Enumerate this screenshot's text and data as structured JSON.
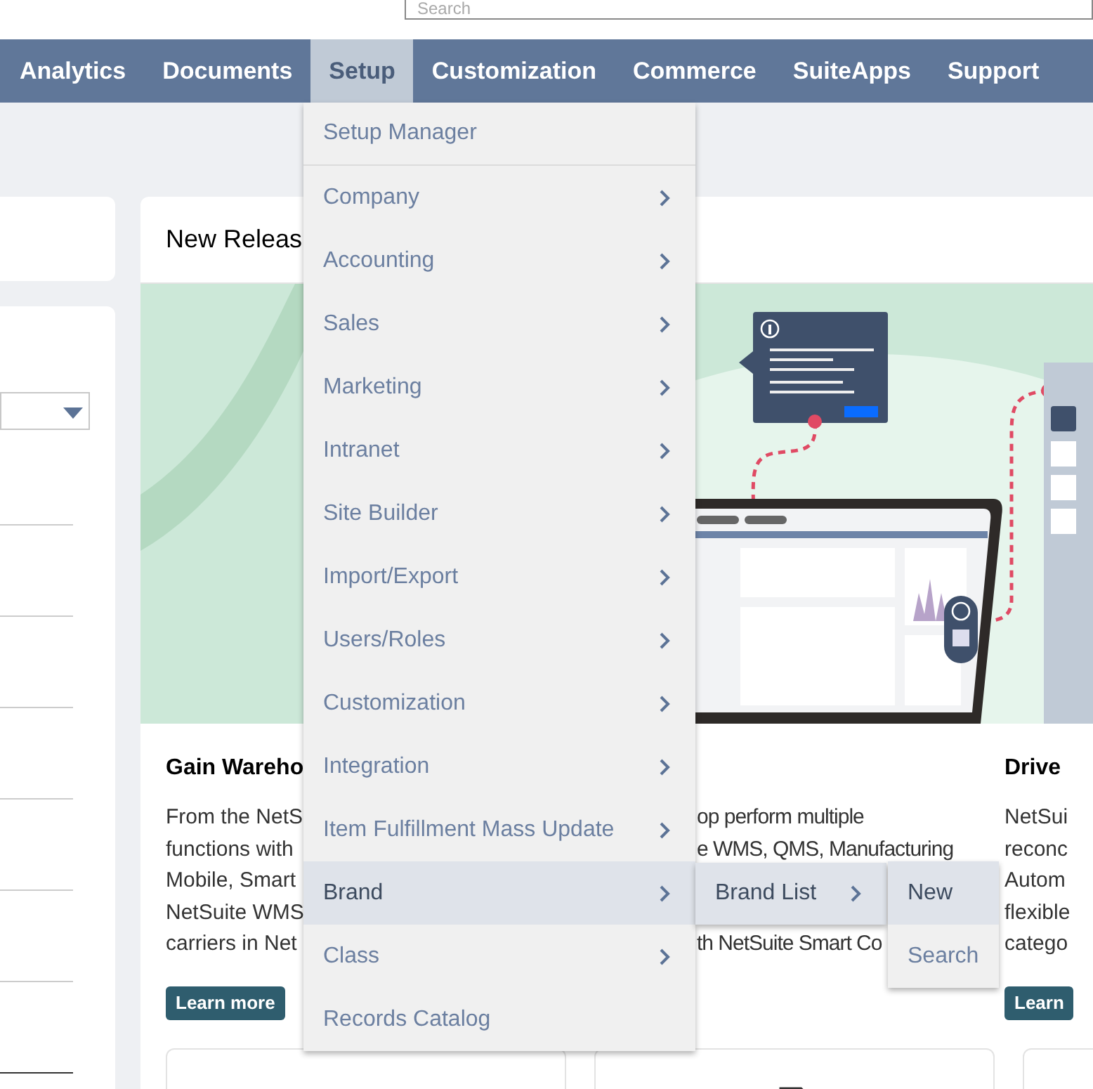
{
  "search": {
    "placeholder": "Search"
  },
  "nav": [
    {
      "label": "Analytics",
      "selected": false
    },
    {
      "label": "Documents",
      "selected": false
    },
    {
      "label": "Setup",
      "selected": true
    },
    {
      "label": "Customization",
      "selected": false
    },
    {
      "label": "Commerce",
      "selected": false
    },
    {
      "label": "SuiteApps",
      "selected": false
    },
    {
      "label": "Support",
      "selected": false
    }
  ],
  "new_releases": {
    "title": "New Releas",
    "articles": [
      {
        "title": "Gain Wareho",
        "lines": [
          {
            "kind": "text",
            "text": "From the NetS"
          },
          {
            "kind": "text",
            "text": "functions with"
          },
          {
            "kind": "text",
            "text": "Mobile, Smart"
          },
          {
            "kind": "text",
            "text": "NetSuite WMS"
          },
          {
            "kind": "text",
            "text": "carriers in Net"
          }
        ],
        "button": "Learn more"
      },
      {
        "lines": [
          {
            "kind": "text",
            "text": "op perform multiple"
          },
          {
            "kind": "text",
            "text": "e WMS, QMS, Manufacturing"
          },
          {
            "kind": "covered"
          },
          {
            "kind": "covered"
          },
          {
            "kind": "text",
            "text": "th NetSuite Smart Co"
          }
        ]
      },
      {
        "title": "Drive",
        "lines": [
          {
            "kind": "text",
            "text": "NetSui"
          },
          {
            "kind": "text",
            "text": "reconc"
          },
          {
            "kind": "text",
            "text": "Autom"
          },
          {
            "kind": "text",
            "text": "flexible"
          },
          {
            "kind": "text",
            "text": "catego"
          }
        ],
        "button": "Learn"
      }
    ]
  },
  "setup_menu": [
    {
      "label": "Setup Manager",
      "submenu": false,
      "selected": false
    },
    {
      "label": "Company",
      "submenu": true,
      "selected": false
    },
    {
      "label": "Accounting",
      "submenu": true,
      "selected": false
    },
    {
      "label": "Sales",
      "submenu": true,
      "selected": false
    },
    {
      "label": "Marketing",
      "submenu": true,
      "selected": false
    },
    {
      "label": "Intranet",
      "submenu": true,
      "selected": false
    },
    {
      "label": "Site Builder",
      "submenu": true,
      "selected": false
    },
    {
      "label": "Import/Export",
      "submenu": true,
      "selected": false
    },
    {
      "label": "Users/Roles",
      "submenu": true,
      "selected": false
    },
    {
      "label": "Customization",
      "submenu": true,
      "selected": false
    },
    {
      "label": "Integration",
      "submenu": true,
      "selected": false
    },
    {
      "label": "Item Fulfillment Mass Update",
      "submenu": true,
      "selected": false
    },
    {
      "label": "Brand",
      "submenu": true,
      "selected": true
    },
    {
      "label": "Class",
      "submenu": true,
      "selected": false
    },
    {
      "label": "Records Catalog",
      "submenu": false,
      "selected": false
    }
  ],
  "brand_submenu": [
    {
      "label": "Brand List",
      "submenu": true,
      "selected": true
    }
  ],
  "brand_list_submenu": [
    {
      "label": "New",
      "selected": true
    },
    {
      "label": "Search",
      "selected": false
    }
  ]
}
